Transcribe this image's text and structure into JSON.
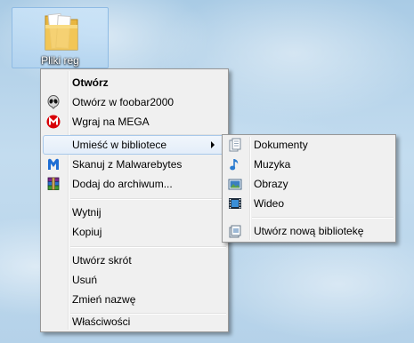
{
  "desktop": {
    "icon_label": "Pliki reg"
  },
  "context_menu": {
    "items": [
      {
        "label": "Otwórz",
        "icon": "none"
      },
      {
        "label": "Otwórz w foobar2000",
        "icon": "foobar-alien-icon"
      },
      {
        "label": "Wgraj na MEGA",
        "icon": "mega-icon"
      },
      {
        "label": "Umieść w bibliotece",
        "icon": "none"
      },
      {
        "label": "Skanuj z Malwarebytes",
        "icon": "malwarebytes-icon"
      },
      {
        "label": "Dodaj do archiwum...",
        "icon": "winrar-icon"
      },
      {
        "label": "Wytnij",
        "icon": "none"
      },
      {
        "label": "Kopiuj",
        "icon": "none"
      },
      {
        "label": "Utwórz skrót",
        "icon": "none"
      },
      {
        "label": "Usuń",
        "icon": "none"
      },
      {
        "label": "Zmień nazwę",
        "icon": "none"
      },
      {
        "label": "Właściwości",
        "icon": "none"
      }
    ]
  },
  "library_submenu": {
    "items": [
      {
        "label": "Dokumenty",
        "icon": "documents-library-icon"
      },
      {
        "label": "Muzyka",
        "icon": "music-library-icon"
      },
      {
        "label": "Obrazy",
        "icon": "pictures-library-icon"
      },
      {
        "label": "Wideo",
        "icon": "video-library-icon"
      },
      {
        "label": "Utwórz nową bibliotekę",
        "icon": "new-library-icon"
      }
    ]
  },
  "colors": {
    "menu_background": "#f0f0f0",
    "menu_border": "#979797",
    "highlight_border": "#a8c8ea",
    "mega_red": "#d90007",
    "malwarebytes_blue": "#1f6ed4"
  }
}
